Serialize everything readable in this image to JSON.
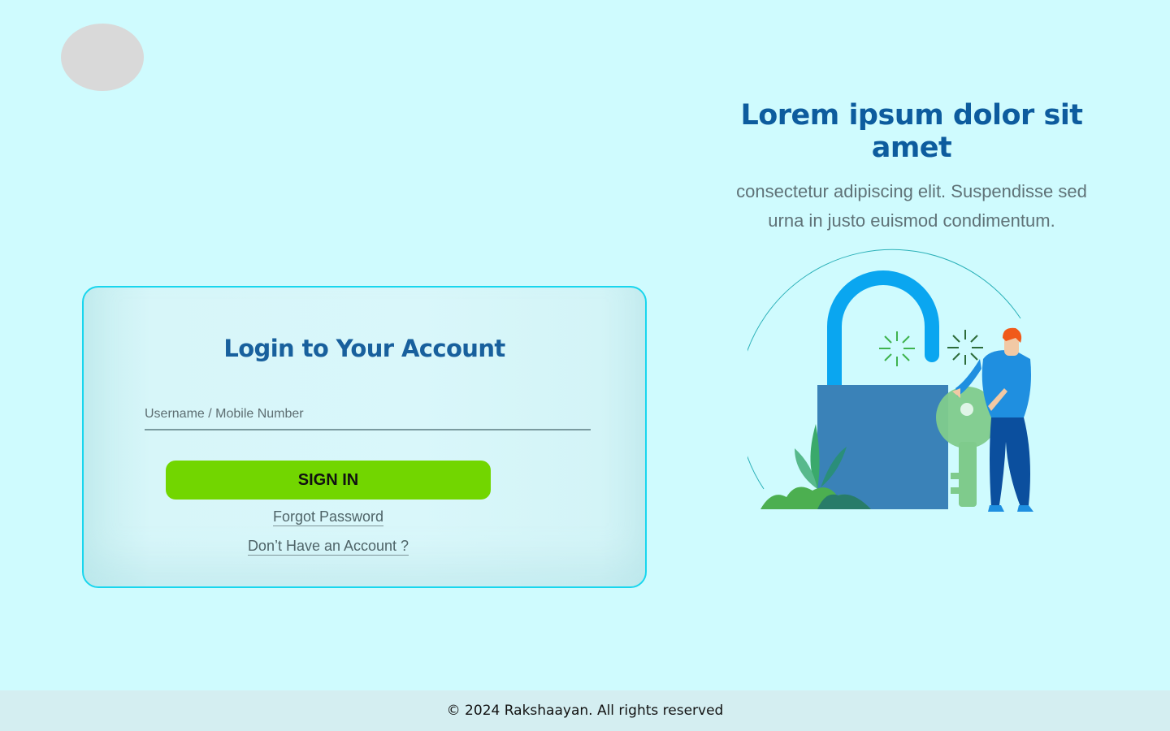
{
  "hero": {
    "title": "Lorem ipsum dolor sit amet",
    "subtitle_line1": "consectetur adipiscing elit. Suspendisse sed",
    "subtitle_line2": "urna in justo euismod condimentum."
  },
  "login": {
    "title": "Login to Your Account",
    "username_placeholder": "Username / Mobile Number",
    "username_value": "",
    "sign_in_label": "SIGN IN",
    "forgot_password_label": "Forgot Password",
    "register_label": "Don’t Have an Account ?"
  },
  "footer": {
    "copyright": "© 2024 Rakshaayan. All rights reserved"
  },
  "colors": {
    "background": "#cffbfe",
    "accent_blue": "#0d5c9e",
    "card_border": "#18d6ee",
    "sign_in_button": "#72d600",
    "lock_body": "#3a82b8",
    "lock_shackle": "#0aa6f0",
    "key": "#7fcb8c"
  },
  "icons": {
    "logo": "logo-placeholder",
    "illustration": "padlock-key-person-illustration"
  }
}
